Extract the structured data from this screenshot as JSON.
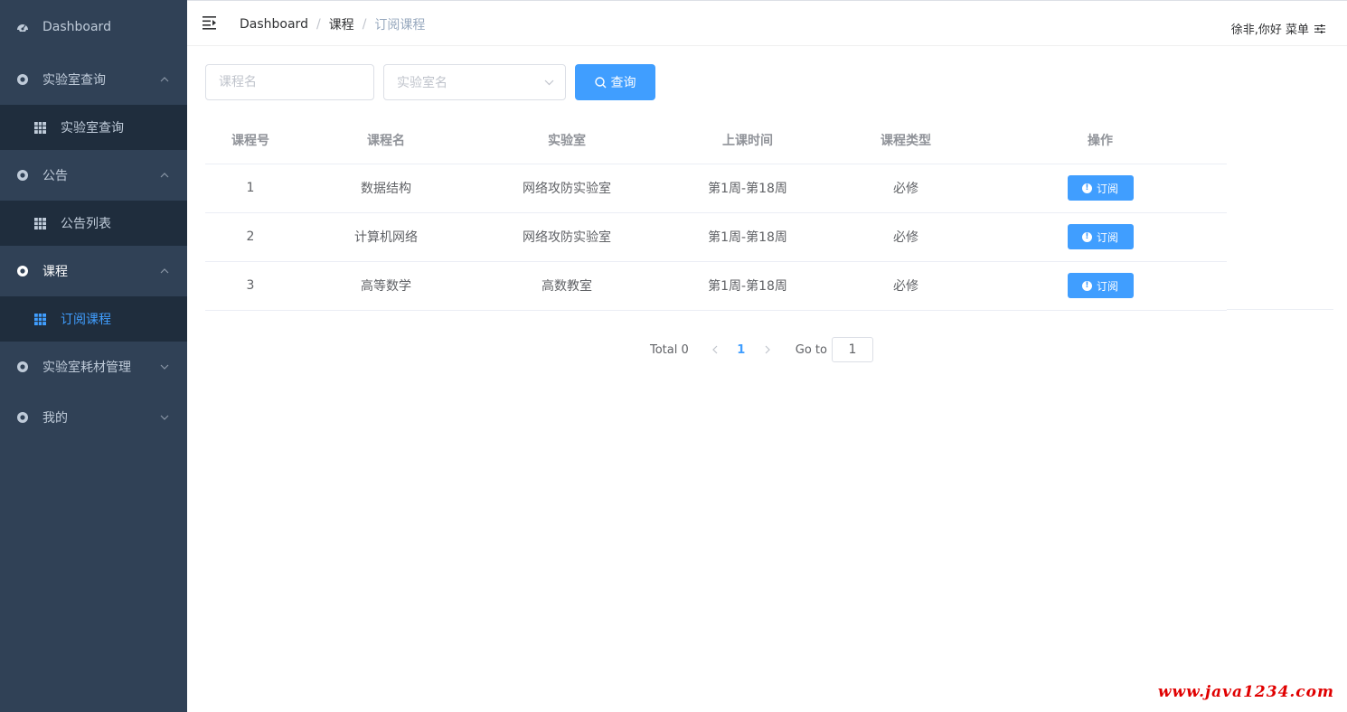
{
  "sidebar": {
    "items": [
      {
        "label": "Dashboard",
        "icon": "dashboard-icon"
      },
      {
        "label": "实验室查询",
        "icon": "circle-icon",
        "expanded": true,
        "children": [
          {
            "label": "实验室查询",
            "icon": "table-icon"
          }
        ]
      },
      {
        "label": "公告",
        "icon": "circle-icon",
        "expanded": true,
        "children": [
          {
            "label": "公告列表",
            "icon": "table-icon"
          }
        ]
      },
      {
        "label": "课程",
        "icon": "circle-icon",
        "expanded": true,
        "children": [
          {
            "label": "订阅课程",
            "icon": "table-icon",
            "active": true
          }
        ]
      },
      {
        "label": "实验室耗材管理",
        "icon": "circle-icon",
        "expanded": false
      },
      {
        "label": "我的",
        "icon": "circle-icon",
        "expanded": false
      }
    ]
  },
  "header": {
    "breadcrumb": [
      "Dashboard",
      "课程",
      "订阅课程"
    ],
    "user": "徐非,你好 菜单"
  },
  "search": {
    "course_placeholder": "课程名",
    "lab_placeholder": "实验室名",
    "query_label": "查询"
  },
  "table": {
    "columns": [
      "课程号",
      "课程名",
      "实验室",
      "上课时间",
      "课程类型",
      "操作"
    ],
    "rows": [
      {
        "id": "1",
        "name": "数据结构",
        "lab": "网络攻防实验室",
        "time": "第1周-第18周",
        "type": "必修",
        "action": "订阅"
      },
      {
        "id": "2",
        "name": "计算机网络",
        "lab": "网络攻防实验室",
        "time": "第1周-第18周",
        "type": "必修",
        "action": "订阅"
      },
      {
        "id": "3",
        "name": "高等数学",
        "lab": "高数教室",
        "time": "第1周-第18周",
        "type": "必修",
        "action": "订阅"
      }
    ]
  },
  "pagination": {
    "total": "Total 0",
    "current_page": "1",
    "goto_label": "Go to",
    "goto_value": "1"
  },
  "watermark": "www.java1234.com",
  "colors": {
    "sidebar_bg": "#304156",
    "submenu_bg": "#1f2d3d",
    "primary": "#409eff",
    "sidebar_text": "#bfcbd9"
  }
}
